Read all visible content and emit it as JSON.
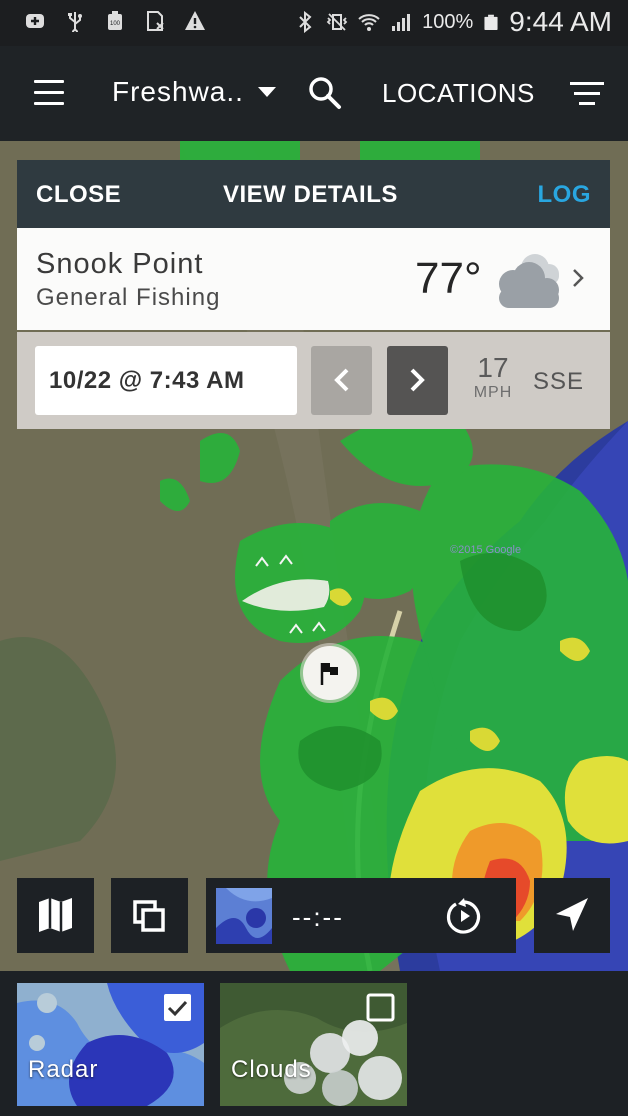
{
  "status_bar": {
    "battery_label": "100",
    "battery_percent": "100%",
    "time": "9:44 AM",
    "left_icons": [
      "plus-badge-icon",
      "usb-icon",
      "battery-100-icon",
      "sim-off-icon",
      "warning-icon"
    ],
    "right_icons": [
      "bluetooth-icon",
      "vibrate-off-icon",
      "wifi-icon",
      "signal-icon",
      "battery-icon"
    ]
  },
  "app_bar": {
    "dropdown_label": "Freshwa..",
    "locations_label": "LOCATIONS"
  },
  "card": {
    "close_label": "CLOSE",
    "details_label": "VIEW DETAILS",
    "log_label": "LOG",
    "log_color": "#29a6e0",
    "location_name": "Snook Point",
    "location_type": "General Fishing",
    "temperature": "77°",
    "weather_icon": "partly-cloudy-icon",
    "date_time": "10/22 @ 7:43 AM",
    "wind_speed": "17",
    "wind_unit": "MPH",
    "wind_direction": "SSE"
  },
  "map": {
    "watermark": "©2015 Google"
  },
  "player": {
    "time_value": "--:--"
  },
  "layers": [
    {
      "label": "Radar",
      "checked": true
    },
    {
      "label": "Clouds",
      "checked": false
    }
  ]
}
